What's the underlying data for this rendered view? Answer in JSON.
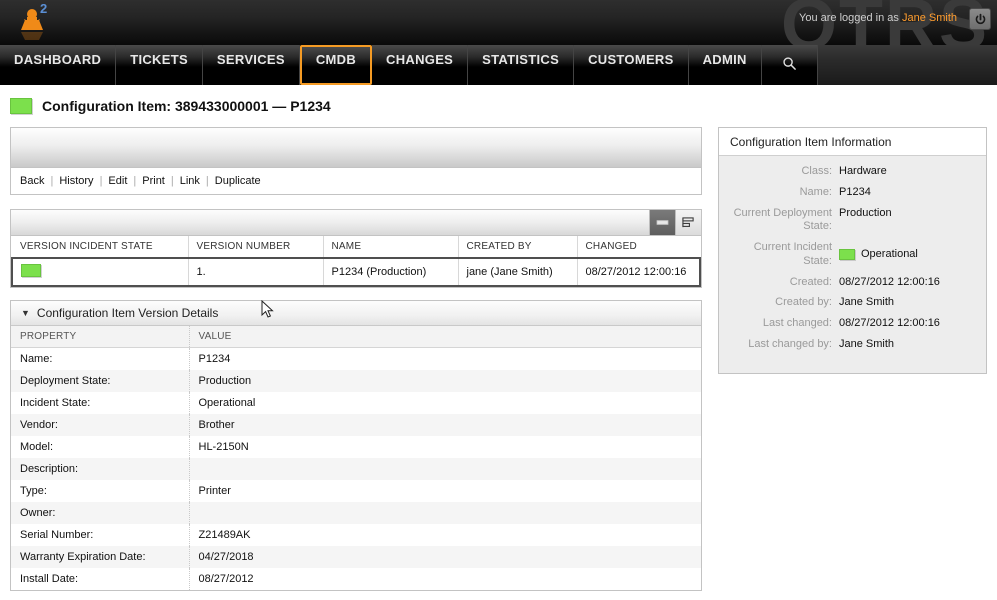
{
  "header": {
    "watermark": "OTRS",
    "agent_badge_count": "2",
    "login_prefix": "You are logged in as",
    "login_user": "Jane Smith",
    "logout_icon": "power-icon",
    "agent_icon": "agent-avatar-icon"
  },
  "nav": {
    "items": [
      {
        "label": "DASHBOARD",
        "active": false
      },
      {
        "label": "TICKETS",
        "active": false
      },
      {
        "label": "SERVICES",
        "active": false
      },
      {
        "label": "CMDB",
        "active": true
      },
      {
        "label": "CHANGES",
        "active": false
      },
      {
        "label": "STATISTICS",
        "active": false
      },
      {
        "label": "CUSTOMERS",
        "active": false
      },
      {
        "label": "ADMIN",
        "active": false
      }
    ],
    "search_icon": "search-icon"
  },
  "page": {
    "title": "Configuration Item: 389433000001 — P1234",
    "state_color": "#7ce04c"
  },
  "actions": {
    "links": [
      "Back",
      "History",
      "Edit",
      "Print",
      "Link",
      "Duplicate"
    ],
    "separator": "|"
  },
  "version_widget": {
    "collapse_icon": "minimize-icon",
    "settings_icon": "column-settings-icon",
    "columns": [
      "VERSION INCIDENT STATE",
      "VERSION NUMBER",
      "NAME",
      "CREATED BY",
      "CHANGED"
    ],
    "rows": [
      {
        "incident_state": "",
        "incident_state_color": "#7ce04c",
        "version_number": "1.",
        "name": "P1234 (Production)",
        "created_by": "jane (Jane Smith)",
        "changed": "08/27/2012 12:00:16"
      }
    ]
  },
  "details_widget": {
    "title": "Configuration Item Version Details",
    "toggle_icon": "triangle-down-icon",
    "columns": [
      "PROPERTY",
      "VALUE"
    ],
    "rows": [
      {
        "property": "Name:",
        "value": "P1234"
      },
      {
        "property": "Deployment State:",
        "value": "Production"
      },
      {
        "property": "Incident State:",
        "value": "Operational"
      },
      {
        "property": "Vendor:",
        "value": "Brother"
      },
      {
        "property": "Model:",
        "value": "HL-2150N"
      },
      {
        "property": "Description:",
        "value": ""
      },
      {
        "property": "Type:",
        "value": "Printer"
      },
      {
        "property": "Owner:",
        "value": ""
      },
      {
        "property": "Serial Number:",
        "value": "Z21489AK"
      },
      {
        "property": "Warranty Expiration Date:",
        "value": "04/27/2018"
      },
      {
        "property": "Install Date:",
        "value": "08/27/2012"
      }
    ]
  },
  "sidebar": {
    "title": "Configuration Item Information",
    "rows": [
      {
        "label": "Class:",
        "value": "Hardware",
        "box": false
      },
      {
        "label": "Name:",
        "value": "P1234",
        "box": false
      },
      {
        "label": "Current Deployment State:",
        "value": "Production",
        "box": false
      },
      {
        "label": "Current Incident State:",
        "value": "Operational",
        "box": true,
        "box_color": "#7ce04c"
      },
      {
        "label": "Created:",
        "value": "08/27/2012 12:00:16",
        "box": false
      },
      {
        "label": "Created by:",
        "value": "Jane Smith",
        "box": false
      },
      {
        "label": "Last changed:",
        "value": "08/27/2012 12:00:16",
        "box": false
      },
      {
        "label": "Last changed by:",
        "value": "Jane Smith",
        "box": false
      }
    ]
  }
}
